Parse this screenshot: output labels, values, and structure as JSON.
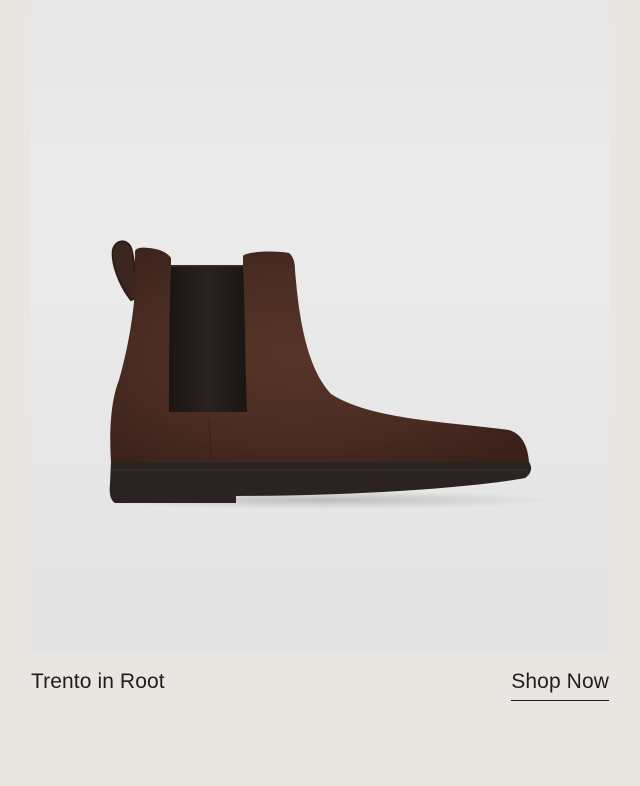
{
  "product": {
    "caption": "Trento in Root",
    "image_icon": "chelsea-boot-image",
    "colors": {
      "suede": "#4a2c22",
      "elastic": "#1f1a18",
      "sole": "#2a2321",
      "backdrop": "#e8e8e8"
    }
  },
  "cta": {
    "label": "Shop Now"
  }
}
